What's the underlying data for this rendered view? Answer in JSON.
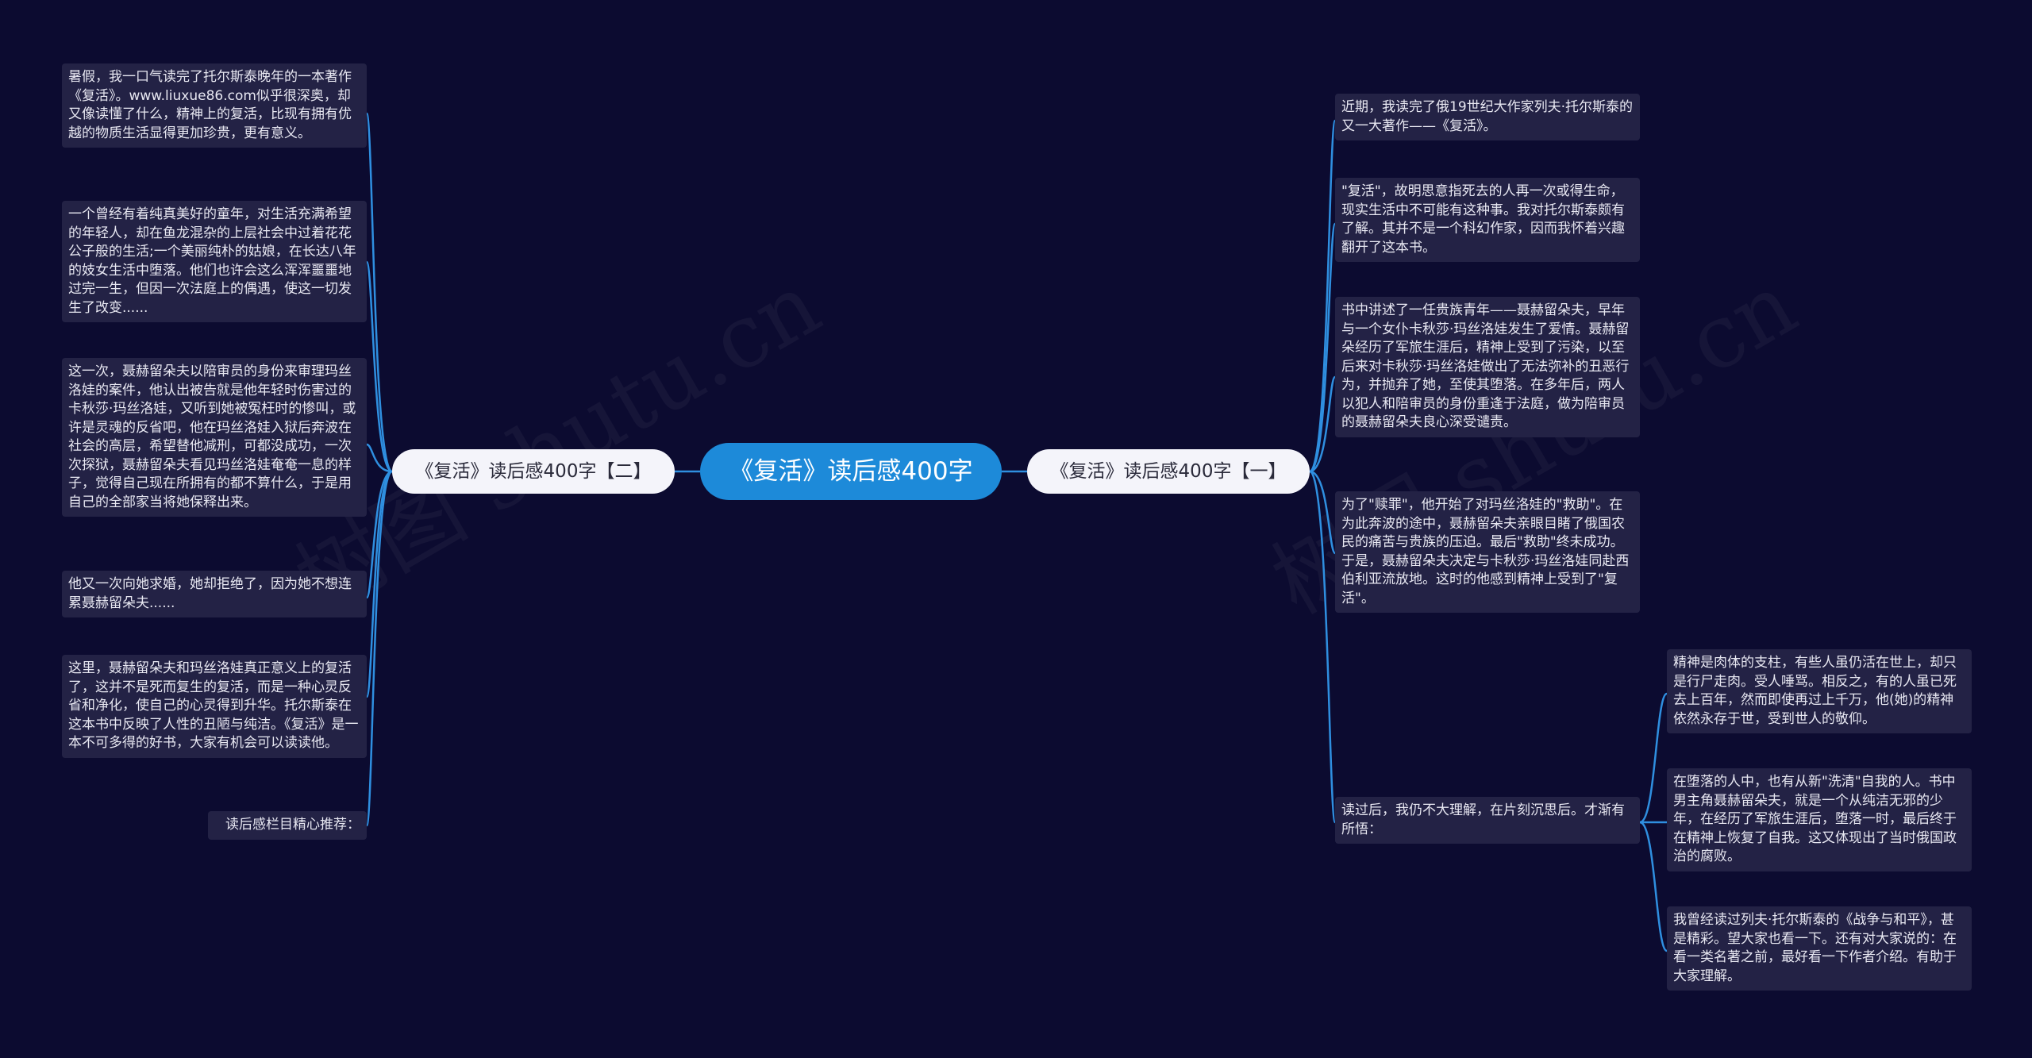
{
  "root": "《复活》读后感400字",
  "left_branch": {
    "label": "《复活》读后感400字【二】",
    "items": [
      "暑假，我一口气读完了托尔斯泰晚年的一本著作《复活》。www.liuxue86.com似乎很深奥，却又像读懂了什么，精神上的复活，比现有拥有优越的物质生活显得更加珍贵，更有意义。",
      "一个曾经有着纯真美好的童年，对生活充满希望的年轻人，却在鱼龙混杂的上层社会中过着花花公子般的生活;一个美丽纯朴的姑娘，在长达八年的妓女生活中堕落。他们也许会这么浑浑噩噩地过完一生，但因一次法庭上的偶遇，使这一切发生了改变......",
      "这一次，聂赫留朵夫以陪审员的身份来审理玛丝洛娃的案件，他认出被告就是他年轻时伤害过的卡秋莎·玛丝洛娃，又听到她被冤枉时的惨叫，或许是灵魂的反省吧，他在玛丝洛娃入狱后奔波在社会的高层，希望替他减刑，可都没成功，一次次探狱，聂赫留朵夫看见玛丝洛娃奄奄一息的样子，觉得自己现在所拥有的都不算什么，于是用自己的全部家当将她保释出来。",
      "他又一次向她求婚，她却拒绝了，因为她不想连累聂赫留朵夫......",
      "这里，聂赫留朵夫和玛丝洛娃真正意义上的复活了，这并不是死而复生的复活，而是一种心灵反省和净化，使自己的心灵得到升华。托尔斯泰在这本书中反映了人性的丑陋与纯洁。《复活》是一本不可多得的好书，大家有机会可以读读他。",
      "读后感栏目精心推荐："
    ]
  },
  "right_branch": {
    "label": "《复活》读后感400字【一】",
    "items": [
      "近期，我读完了俄19世纪大作家列夫·托尔斯泰的又一大著作——《复活》。",
      "\"复活\"，故明思意指死去的人再一次或得生命，现实生活中不可能有这种事。我对托尔斯泰颇有了解。其并不是一个科幻作家，因而我怀着兴趣翻开了这本书。",
      "书中讲述了一任贵族青年——聂赫留朵夫，早年与一个女仆卡秋莎·玛丝洛娃发生了爱情。聂赫留朵经历了军旅生涯后，精神上受到了污染，以至后来对卡秋莎·玛丝洛娃做出了无法弥补的丑恶行为，并抛弃了她，至使其堕落。在多年后，两人以犯人和陪审员的身份重逢于法庭，做为陪审员的聂赫留朵夫良心深受谴责。",
      "为了\"赎罪\"，他开始了对玛丝洛娃的\"救助\"。在为此奔波的途中，聂赫留朵夫亲眼目睹了俄国农民的痛苦与贵族的压迫。最后\"救助\"终未成功。于是，聂赫留朵夫决定与卡秋莎·玛丝洛娃同赴西伯利亚流放地。这时的他感到精神上受到了\"复活\"。",
      "读过后，我仍不大理解，在片刻沉思后。才渐有所悟："
    ],
    "sub_items": [
      "精神是肉体的支柱，有些人虽仍活在世上，却只是行尸走肉。受人唾骂。相反之，有的人虽已死去上百年，然而即使再过上千万，他(她)的精神依然永存于世，受到世人的敬仰。",
      "在堕落的人中，也有从新\"洗清\"自我的人。书中男主角聂赫留朵夫，就是一个从纯洁无邪的少年，在经历了军旅生涯后，堕落一时，最后终于在精神上恢复了自我。这又体现出了当时俄国政治的腐败。",
      "我曾经读过列夫·托尔斯泰的《战争与和平》，甚是精彩。望大家也看一下。还有对大家说的：在看一类名著之前，最好看一下作者介绍。有助于大家理解。"
    ]
  },
  "watermark": "树图 shutu.cn"
}
